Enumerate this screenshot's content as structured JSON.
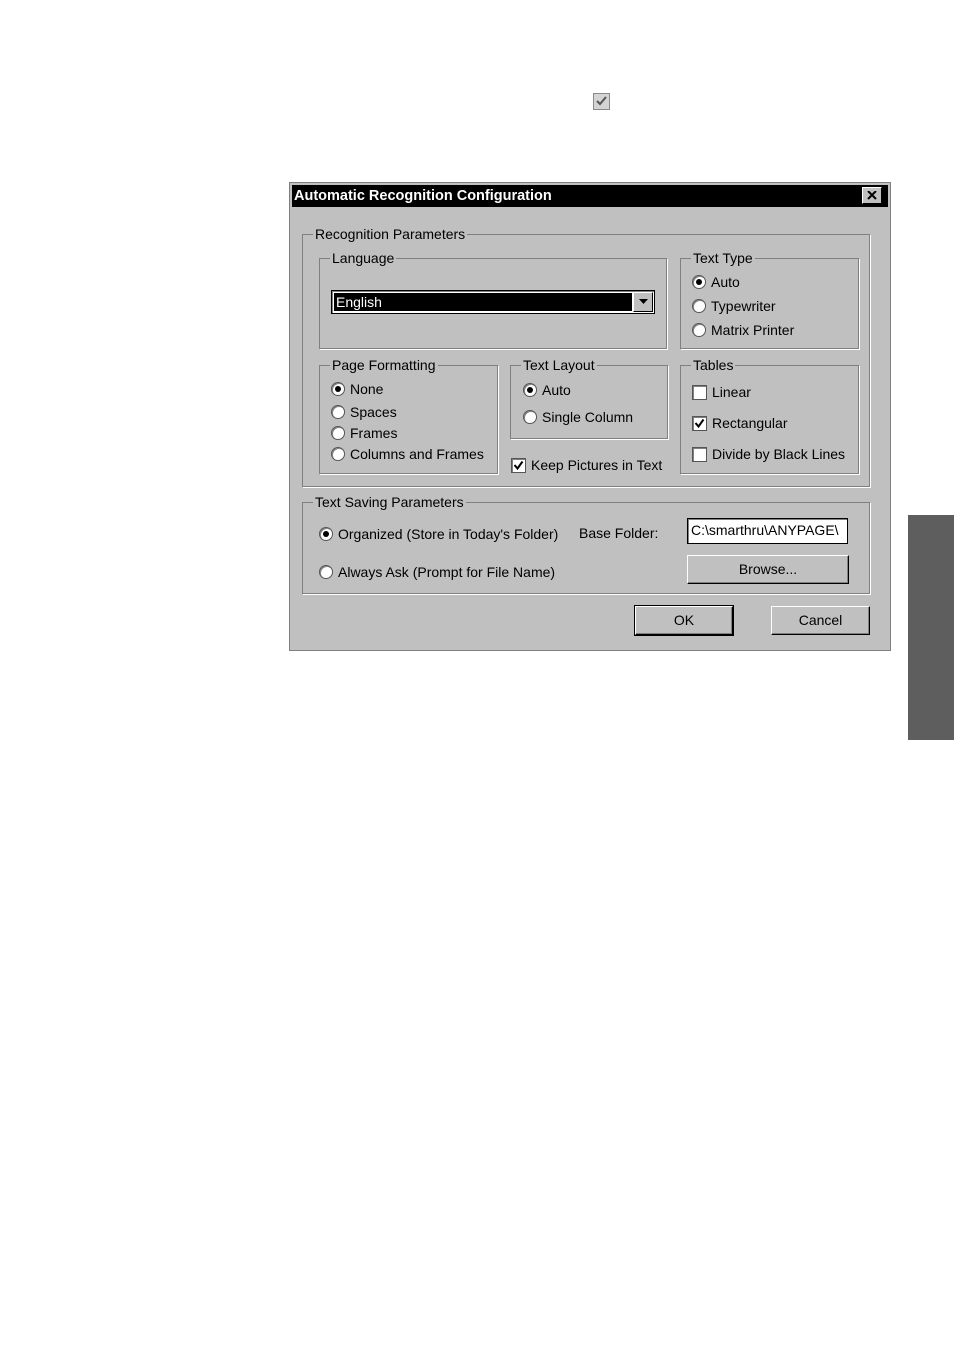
{
  "dialog": {
    "title": "Automatic Recognition Configuration",
    "close_icon": "close-x-icon"
  },
  "recognition": {
    "legend": "Recognition Parameters",
    "language": {
      "legend": "Language",
      "selected": "English"
    },
    "text_type": {
      "legend": "Text Type",
      "options": [
        "Auto",
        "Typewriter",
        "Matrix Printer"
      ],
      "selected": "Auto"
    },
    "page_formatting": {
      "legend": "Page Formatting",
      "options": [
        "None",
        "Spaces",
        "Frames",
        "Columns and Frames"
      ],
      "selected": "None"
    },
    "text_layout": {
      "legend": "Text Layout",
      "options": [
        "Auto",
        "Single Column"
      ],
      "selected": "Auto"
    },
    "keep_pictures": {
      "label": "Keep Pictures in Text",
      "checked": true
    },
    "tables": {
      "legend": "Tables",
      "options": [
        {
          "label": "Linear",
          "checked": false
        },
        {
          "label": "Rectangular",
          "checked": true
        },
        {
          "label": "Divide by Black Lines",
          "checked": false
        }
      ]
    }
  },
  "saving": {
    "legend": "Text Saving Parameters",
    "organized_label": "Organized (Store in Today's Folder)",
    "always_ask_label": "Always Ask (Prompt for File Name)",
    "selected": "Organized (Store in Today's Folder)",
    "base_folder_label": "Base Folder:",
    "base_folder_value": "C:\\smarthru\\ANYPAGE\\",
    "browse_label": "Browse..."
  },
  "buttons": {
    "ok": "OK",
    "cancel": "Cancel"
  },
  "colors": {
    "dialog_bg": "#c0c0c0",
    "titlebar_bg": "#000000",
    "side_tab": "#5e5e5e"
  }
}
